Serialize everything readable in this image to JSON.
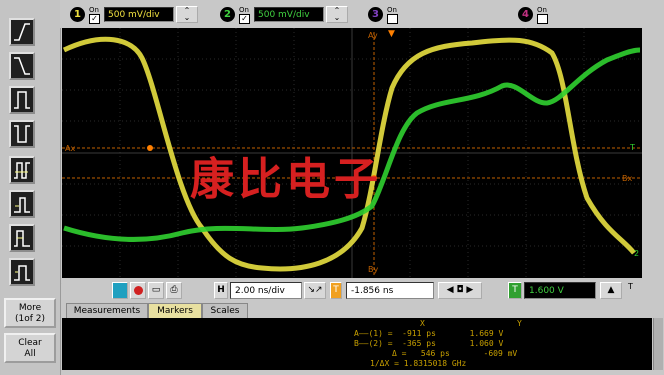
{
  "top": {
    "ch1": {
      "num": "1",
      "on": "On",
      "scale": "500 mV/div",
      "color": "#f0e040"
    },
    "ch2": {
      "num": "2",
      "on": "On",
      "scale": "500 mV/div",
      "color": "#40d040"
    },
    "ch3": {
      "num": "3",
      "on": "On",
      "color": "#8040c0"
    },
    "ch4": {
      "num": "4",
      "on": "On",
      "color": "#c03080"
    }
  },
  "sidebar": {
    "more_line1": "More",
    "more_line2": "(1of 2)",
    "clear_line1": "Clear",
    "clear_line2": "All"
  },
  "screen": {
    "marker_ax": "Ax",
    "marker_bx": "Bx",
    "marker_ay": "Ay",
    "marker_by": "By",
    "trig_label": "T",
    "ch2_label": "2",
    "left_marker": "T"
  },
  "controls": {
    "timebase_h": "H",
    "timebase": "2.00 ns/div",
    "delay_label": "T",
    "delay": "-1.856 ns",
    "trigger_label": "T",
    "trigger_level": "1.600 V",
    "right_t": "T"
  },
  "tabs": [
    "Measurements",
    "Markers",
    "Scales"
  ],
  "markers": {
    "header_x": "X",
    "header_y": "Y",
    "row1": "A——(1) =  -911 ps       1.669 V",
    "row2": "B——(2) =  -365 ps       1.060 V",
    "row3": "Δ =   546 ps       -609 mV",
    "row4": "1/ΔX = 1.8315018 GHz"
  },
  "watermark": "康比电子"
}
